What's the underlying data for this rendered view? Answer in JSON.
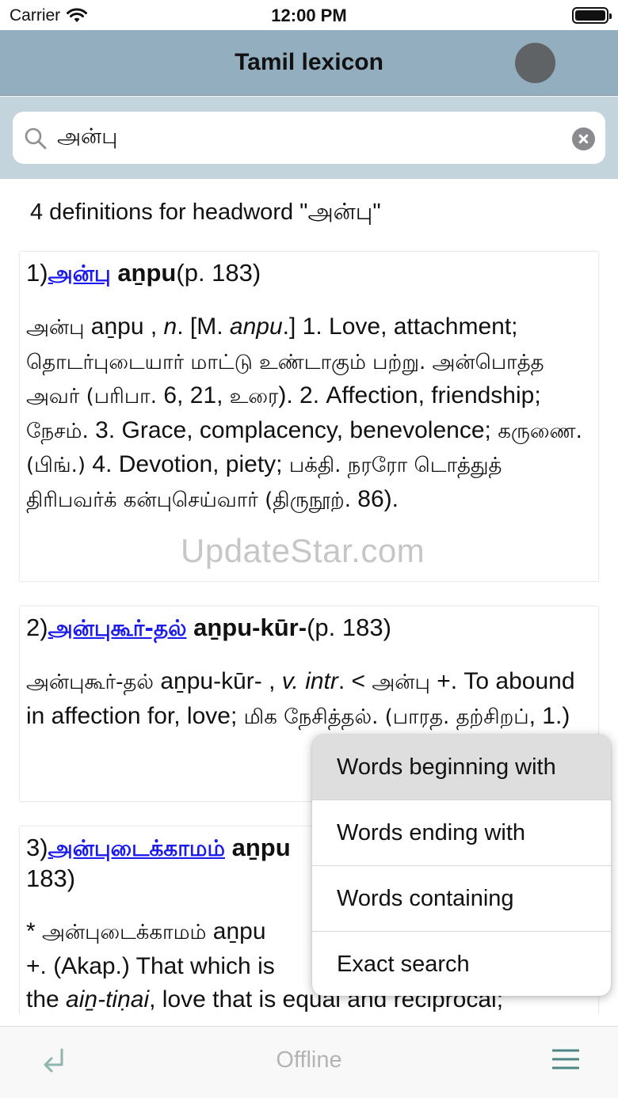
{
  "status_bar": {
    "carrier": "Carrier",
    "time": "12:00 PM"
  },
  "nav": {
    "title": "Tamil lexicon"
  },
  "search": {
    "value": "அன்பு",
    "placeholder": ""
  },
  "results": {
    "count_text": "4 definitions for headword \"அன்பு\"",
    "entries": [
      {
        "number": "1)",
        "headword": "அன்பு",
        "translit": "aṉpu",
        "page": "(p. 183)",
        "def": {
          "w1": "அன்பு",
          "t1": " aṉpu , ",
          "i1": "n",
          "t2": ". [M. ",
          "i2": "anpu",
          "t3": ".] 1. Love, attachment; ",
          "w2": "தொடர்புடையார் மாட்டு உண்டாகும் பற்று. அன்பொத்த அவர் (பரிபா.",
          "t4": " 6, 21, ",
          "w3": "உரை",
          "t5": "). 2. Affection, friendship; ",
          "w4": "நேசம்",
          "t6": ". 3. Grace, complacency, benevolence; ",
          "w5": "கருணை. (பிங்.)",
          "t7": " 4. Devotion, piety; ",
          "w6": "பக்தி. நரரோ டொத்துத் திரிபவர்க் கன்புசெய்வார் (திருநூற்.",
          "t8": " 86)."
        }
      },
      {
        "number": "2)",
        "headword": "அன்புகூர்-தல்",
        "translit": "aṉpu-kūr-",
        "page": "(p. 183)",
        "def": {
          "w1": "அன்புகூர்-தல்",
          "t1": " aṉpu-kūr- , ",
          "i1": "v. intr",
          "t2": ". < ",
          "w2": "அன்பு",
          "t3": " +. To abound in affection for, love; ",
          "w3": "மிக நேசித்தல். (பாரத. தற்சிறப்",
          "t4": ", 1.)"
        }
      },
      {
        "number": "3)",
        "headword": "அன்புடைக்காமம்",
        "translit": "aṉpu",
        "page": "183)",
        "def": {
          "t1": "* ",
          "w1": "அன்புடைக்காமம்",
          "t2": " aṉpu",
          "t3": "+. (Akap.) That which is",
          "t4": "the ",
          "i1": "aiṉ-tiṇai",
          "t5": ", love that is equal and reciprocal;"
        }
      }
    ]
  },
  "watermark": "UpdateStar.com",
  "popup_menu": {
    "items": [
      "Words beginning with",
      "Words ending with",
      "Words containing",
      "Exact search"
    ]
  },
  "bottom_bar": {
    "status": "Offline"
  },
  "icons": {
    "wifi": "wifi-icon",
    "battery": "battery-icon",
    "search": "search-icon",
    "clear": "clear-icon",
    "return": "return-arrow-icon",
    "menu": "hamburger-menu-icon"
  },
  "colors": {
    "nav_bar": "#93aebe",
    "search_area": "#c3d4dd",
    "link": "#1a1aee",
    "icon_accent": "#4e8684"
  }
}
